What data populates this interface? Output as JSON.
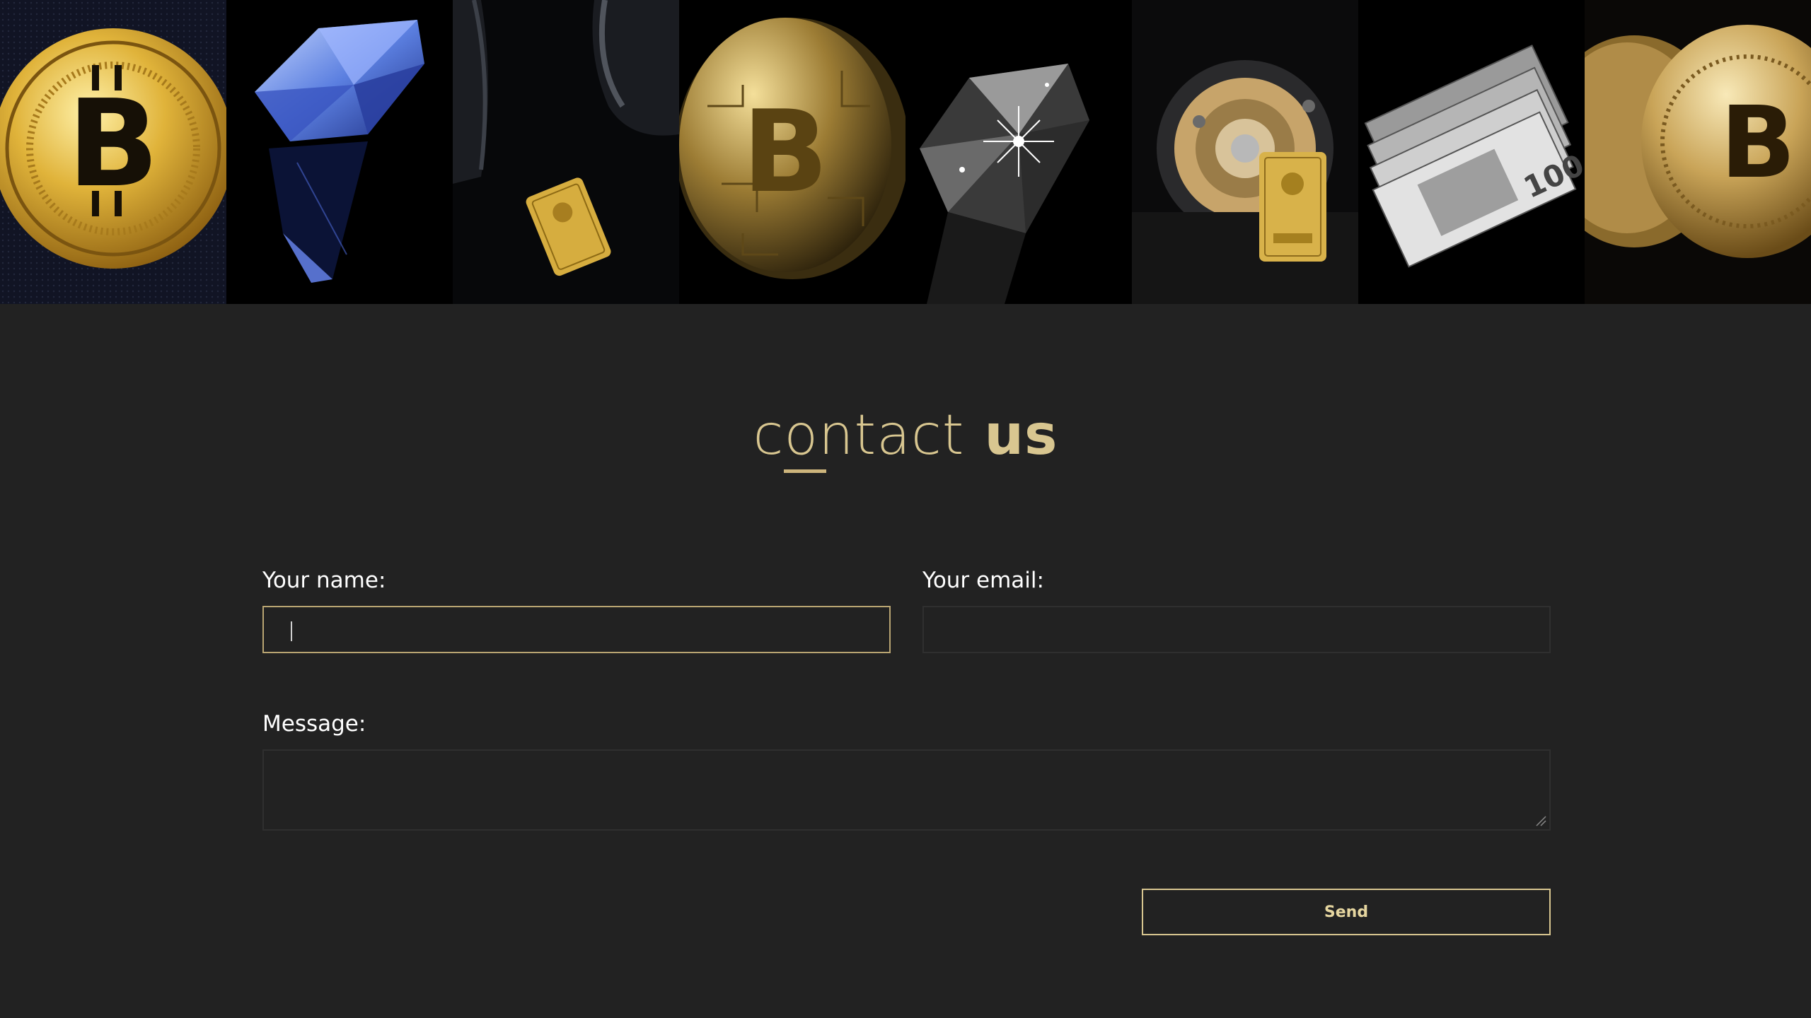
{
  "gallery": {
    "tiles": [
      {
        "name": "bitcoin-coin-image"
      },
      {
        "name": "blue-diamond-image"
      },
      {
        "name": "gold-bar-headphones-image"
      },
      {
        "name": "bitcoin-circuit-coin-image"
      },
      {
        "name": "clear-diamond-image"
      },
      {
        "name": "gold-bar-device-image"
      },
      {
        "name": "dollar-bills-image"
      },
      {
        "name": "bitcoin-coins-stack-image"
      }
    ]
  },
  "contact": {
    "title_light": "contact",
    "title_bold": "us",
    "name_label": "Your name:",
    "email_label": "Your email:",
    "message_label": "Message:",
    "name_value": "",
    "email_value": "",
    "message_value": "",
    "send_label": "Send"
  },
  "colors": {
    "background": "#222222",
    "accent_gold": "#d8c690",
    "label_text": "#ffffff"
  }
}
